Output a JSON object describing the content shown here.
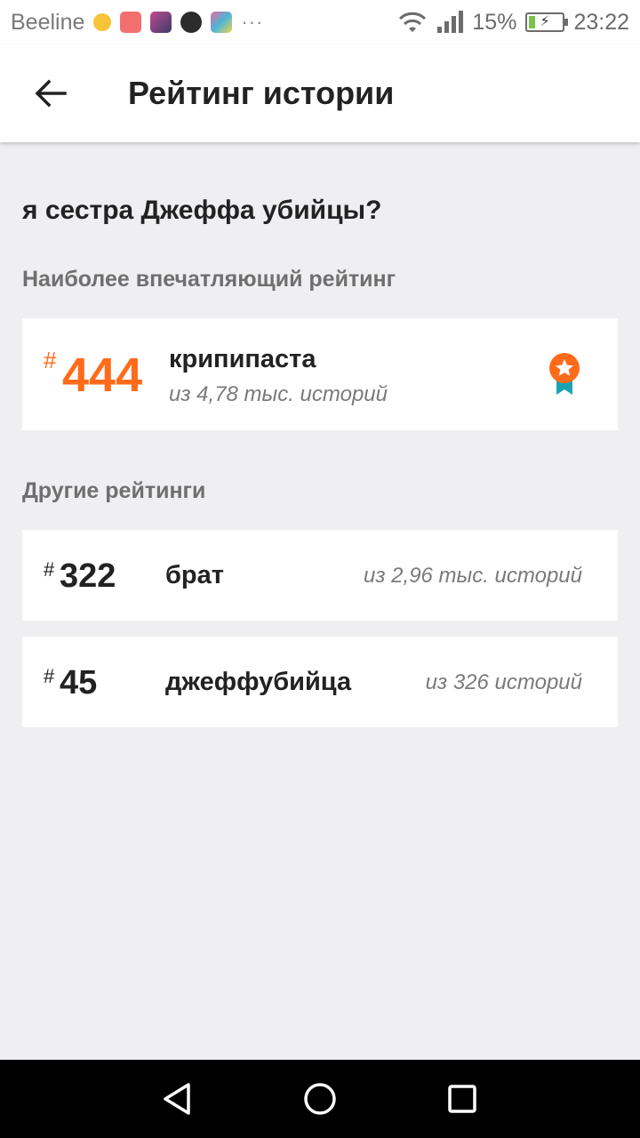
{
  "status_bar": {
    "carrier": "Beeline",
    "battery_percent": "15%",
    "time": "23:22",
    "more": "···"
  },
  "app_bar": {
    "title": "Рейтинг истории",
    "back_icon": "arrow-left-icon"
  },
  "story": {
    "title": "я сестра Джеффа убийцы?"
  },
  "best_ranking": {
    "section_label": "Наиболее впечатляющий рейтинг",
    "hash": "#",
    "rank": "444",
    "tag": "крипипаста",
    "count": "из 4,78 тыс. историй",
    "badge_icon": "medal-star-icon",
    "accent_color": "#ff6b1a"
  },
  "other_rankings": {
    "section_label": "Другие рейтинги",
    "items": [
      {
        "hash": "#",
        "rank": "322",
        "tag": "брат",
        "count": "из 2,96 тыс. историй"
      },
      {
        "hash": "#",
        "rank": "45",
        "tag": "джеффубийца",
        "count": "из 326 историй"
      }
    ]
  },
  "nav_bar": {
    "back_icon": "triangle-back-icon",
    "home_icon": "circle-home-icon",
    "recents_icon": "square-recents-icon"
  }
}
